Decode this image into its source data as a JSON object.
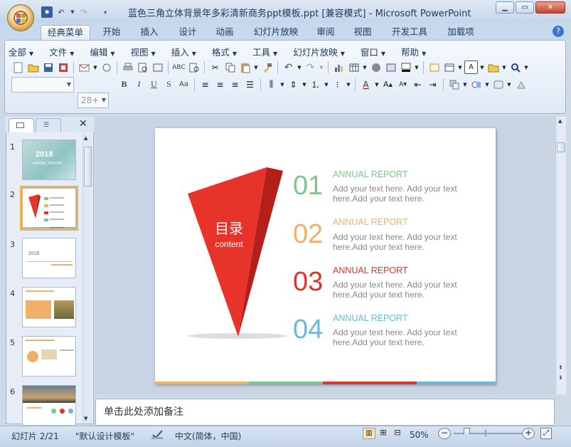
{
  "window": {
    "title": "蓝色三角立体背景年多彩清新商务ppt模板.ppt [兼容模式] - Microsoft PowerPoint"
  },
  "tabs": [
    "经典菜单",
    "开始",
    "插入",
    "设计",
    "动画",
    "幻灯片放映",
    "审阅",
    "视图",
    "开发工具",
    "加载项"
  ],
  "menus": [
    "全部",
    "文件",
    "编辑",
    "视图",
    "插入",
    "格式",
    "工具",
    "幻灯片放映",
    "窗口",
    "帮助"
  ],
  "font": {
    "name_value": "",
    "size_value": "28+"
  },
  "slides": [
    {
      "num": "1",
      "thumb_year": "2018",
      "thumb_sub": "ANNUAL REPORT"
    },
    {
      "num": "2"
    },
    {
      "num": "3",
      "thumb_year": "2018"
    },
    {
      "num": "4"
    },
    {
      "num": "5"
    },
    {
      "num": "6"
    }
  ],
  "slide": {
    "title": "目录",
    "subtitle": "content",
    "items": [
      {
        "num": "01",
        "heading": "ANNUAL REPORT",
        "color": "#7ec48f",
        "body": "Add your text here. Add your text here.Add your text here."
      },
      {
        "num": "02",
        "heading": "ANNUAL REPORT",
        "color": "#f0b06a",
        "body": "Add your text here. Add your text here.Add your text here."
      },
      {
        "num": "03",
        "heading": "ANNUAL REPORT",
        "color": "#d9372b",
        "body": "Add your text here. Add your text here.Add your text here."
      },
      {
        "num": "04",
        "heading": "ANNUAL REPORT",
        "color": "#6ab9d9",
        "body": "Add your text here. Add your text here.Add your text here."
      }
    ],
    "bottom_bar_colors": [
      "#f0b06a",
      "#7ec48f",
      "#d9372b",
      "#6ab9d9"
    ]
  },
  "notes": {
    "placeholder": "单击此处添加备注"
  },
  "status": {
    "slide_info": "幻灯片 2/21",
    "theme": "\"默认设计模板\"",
    "language": "中文(简体，中国)",
    "zoom": "50%"
  },
  "colors": {
    "accent_red": "#e8332a",
    "ribbon_bg": "#dfe9f5"
  }
}
